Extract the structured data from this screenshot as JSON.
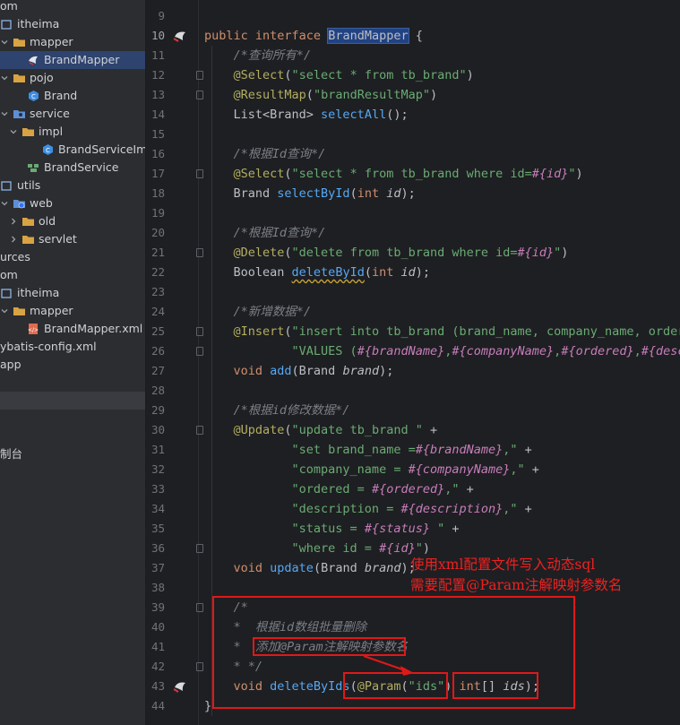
{
  "project_tree": {
    "items": [
      {
        "label": "om",
        "icon": "none-icon",
        "indent": 0,
        "chevron": ""
      },
      {
        "label": "itheima",
        "icon": "package-icon",
        "indent": 0,
        "chevron": ""
      },
      {
        "label": "mapper",
        "icon": "folder-icon",
        "indent": 0,
        "chevron": "down"
      },
      {
        "label": "BrandMapper",
        "icon": "mybatis-mapper-icon",
        "indent": 1,
        "chevron": "",
        "selected": true
      },
      {
        "label": "pojo",
        "icon": "folder-icon",
        "indent": 0,
        "chevron": "down"
      },
      {
        "label": "Brand",
        "icon": "class-icon",
        "indent": 1,
        "chevron": ""
      },
      {
        "label": "service",
        "icon": "service-package-icon",
        "indent": 0,
        "chevron": "down"
      },
      {
        "label": "impl",
        "icon": "folder-icon",
        "indent": 1,
        "chevron": "down"
      },
      {
        "label": "BrandServiceImp",
        "icon": "class-icon",
        "indent": 2,
        "chevron": ""
      },
      {
        "label": "BrandService",
        "icon": "interface-icon",
        "indent": 1,
        "chevron": ""
      },
      {
        "label": "utils",
        "icon": "package-icon",
        "indent": 0,
        "chevron": ""
      },
      {
        "label": "web",
        "icon": "web-package-icon",
        "indent": 0,
        "chevron": "down"
      },
      {
        "label": "old",
        "icon": "folder-icon",
        "indent": 1,
        "chevron": "right"
      },
      {
        "label": "servlet",
        "icon": "folder-icon",
        "indent": 1,
        "chevron": "right"
      },
      {
        "label": "urces",
        "icon": "none-icon",
        "indent": 0,
        "chevron": ""
      },
      {
        "label": "om",
        "icon": "none-icon",
        "indent": 0,
        "chevron": ""
      },
      {
        "label": "itheima",
        "icon": "package-icon",
        "indent": 0,
        "chevron": ""
      },
      {
        "label": "mapper",
        "icon": "folder-icon",
        "indent": 0,
        "chevron": "down"
      },
      {
        "label": "BrandMapper.xml",
        "icon": "xml-file-icon",
        "indent": 1,
        "chevron": ""
      },
      {
        "label": "ybatis-config.xml",
        "icon": "none-icon",
        "indent": 0,
        "chevron": ""
      },
      {
        "label": "app",
        "icon": "none-icon",
        "indent": 0,
        "chevron": ""
      },
      {
        "label": "",
        "icon": "none-icon",
        "indent": 0,
        "chevron": ""
      },
      {
        "label": "",
        "icon": "none-icon",
        "indent": 0,
        "chevron": "",
        "hover": true
      },
      {
        "label": "",
        "icon": "none-icon",
        "indent": 0,
        "chevron": ""
      },
      {
        "label": "",
        "icon": "none-icon",
        "indent": 0,
        "chevron": ""
      },
      {
        "label": "制台",
        "icon": "none-icon",
        "indent": 0,
        "chevron": ""
      }
    ]
  },
  "editor": {
    "current_line": 10,
    "lines": [
      {
        "n": 9,
        "t": []
      },
      {
        "n": 10,
        "t": [
          [
            "kw",
            "public "
          ],
          [
            "kw",
            "interface "
          ],
          [
            "hl",
            "BrandMapper"
          ],
          [
            "tp",
            " {"
          ]
        ]
      },
      {
        "n": 11,
        "t": [
          [
            "cm",
            "    /*查询所有*/"
          ]
        ]
      },
      {
        "n": 12,
        "t": [
          [
            "an",
            "    @Select"
          ],
          [
            "tp",
            "("
          ],
          [
            "st",
            "\"select * from tb_brand\""
          ],
          [
            "tp",
            ")"
          ]
        ]
      },
      {
        "n": 13,
        "t": [
          [
            "an",
            "    @ResultMap"
          ],
          [
            "tp",
            "("
          ],
          [
            "st",
            "\"brandResultMap\""
          ],
          [
            "tp",
            ")"
          ]
        ]
      },
      {
        "n": 14,
        "t": [
          [
            "tp",
            "    List<Brand> "
          ],
          [
            "fn",
            "selectAll"
          ],
          [
            "tp",
            "();"
          ]
        ]
      },
      {
        "n": 15,
        "t": []
      },
      {
        "n": 16,
        "t": [
          [
            "cm",
            "    /*根据Id查询*/"
          ]
        ]
      },
      {
        "n": 17,
        "t": [
          [
            "an",
            "    @Select"
          ],
          [
            "tp",
            "("
          ],
          [
            "st",
            "\"select * from tb_brand where id="
          ],
          [
            "ip",
            "#{id}"
          ],
          [
            "st",
            "\""
          ],
          [
            "tp",
            ")"
          ]
        ]
      },
      {
        "n": 18,
        "t": [
          [
            "tp",
            "    Brand "
          ],
          [
            "fn",
            "selectById"
          ],
          [
            "tp",
            "("
          ],
          [
            "kw",
            "int "
          ],
          [
            "pm",
            "id"
          ],
          [
            "tp",
            ");"
          ]
        ]
      },
      {
        "n": 19,
        "t": []
      },
      {
        "n": 20,
        "t": [
          [
            "cm",
            "    /*根据Id查询*/"
          ]
        ]
      },
      {
        "n": 21,
        "t": [
          [
            "an",
            "    @Delete"
          ],
          [
            "tp",
            "("
          ],
          [
            "st",
            "\"delete from tb_brand where id="
          ],
          [
            "ip",
            "#{id}"
          ],
          [
            "st",
            "\""
          ],
          [
            "tp",
            ")"
          ]
        ]
      },
      {
        "n": 22,
        "t": [
          [
            "tp",
            "    Boolean "
          ],
          [
            "fnsq",
            "deleteById"
          ],
          [
            "tp",
            "("
          ],
          [
            "kw",
            "int "
          ],
          [
            "pm",
            "id"
          ],
          [
            "tp",
            ");"
          ]
        ]
      },
      {
        "n": 23,
        "t": []
      },
      {
        "n": 24,
        "t": [
          [
            "cm",
            "    /*新增数据*/"
          ]
        ]
      },
      {
        "n": 25,
        "t": [
          [
            "an",
            "    @Insert"
          ],
          [
            "tp",
            "("
          ],
          [
            "st",
            "\"insert into tb_brand (brand_name, company_name, ordere"
          ]
        ]
      },
      {
        "n": 26,
        "t": [
          [
            "st",
            "            \"VALUES ("
          ],
          [
            "ip",
            "#{brandName}"
          ],
          [
            "st",
            ","
          ],
          [
            "ip",
            "#{companyName}"
          ],
          [
            "st",
            ","
          ],
          [
            "ip",
            "#{ordered}"
          ],
          [
            "st",
            ","
          ],
          [
            "ip",
            "#{descr"
          ]
        ]
      },
      {
        "n": 27,
        "t": [
          [
            "kw",
            "    void "
          ],
          [
            "fn",
            "add"
          ],
          [
            "tp",
            "(Brand "
          ],
          [
            "pm",
            "brand"
          ],
          [
            "tp",
            ");"
          ]
        ]
      },
      {
        "n": 28,
        "t": []
      },
      {
        "n": 29,
        "t": [
          [
            "cm",
            "    /*根据id修改数据*/"
          ]
        ]
      },
      {
        "n": 30,
        "t": [
          [
            "an",
            "    @Update"
          ],
          [
            "tp",
            "("
          ],
          [
            "st",
            "\"update tb_brand \""
          ],
          [
            "tp",
            " +"
          ]
        ]
      },
      {
        "n": 31,
        "t": [
          [
            "st",
            "            \"set brand_name ="
          ],
          [
            "ip",
            "#{brandName}"
          ],
          [
            "st",
            ",\""
          ],
          [
            "tp",
            " +"
          ]
        ]
      },
      {
        "n": 32,
        "t": [
          [
            "st",
            "            \"company_name = "
          ],
          [
            "ip",
            "#{companyName}"
          ],
          [
            "st",
            ",\""
          ],
          [
            "tp",
            " +"
          ]
        ]
      },
      {
        "n": 33,
        "t": [
          [
            "st",
            "            \"ordered = "
          ],
          [
            "ip",
            "#{ordered}"
          ],
          [
            "st",
            ",\""
          ],
          [
            "tp",
            " +"
          ]
        ]
      },
      {
        "n": 34,
        "t": [
          [
            "st",
            "            \"description = "
          ],
          [
            "ip",
            "#{description}"
          ],
          [
            "st",
            ",\""
          ],
          [
            "tp",
            " +"
          ]
        ]
      },
      {
        "n": 35,
        "t": [
          [
            "st",
            "            \"status = "
          ],
          [
            "ip",
            "#{status}"
          ],
          [
            "st",
            " \""
          ],
          [
            "tp",
            " +"
          ]
        ]
      },
      {
        "n": 36,
        "t": [
          [
            "st",
            "            \"where id = "
          ],
          [
            "ip",
            "#{id}"
          ],
          [
            "st",
            "\""
          ],
          [
            "tp",
            ")"
          ]
        ]
      },
      {
        "n": 37,
        "t": [
          [
            "kw",
            "    void "
          ],
          [
            "fn",
            "update"
          ],
          [
            "tp",
            "(Brand "
          ],
          [
            "pm",
            "brand"
          ],
          [
            "tp",
            ");"
          ]
        ]
      },
      {
        "n": 38,
        "t": []
      },
      {
        "n": 39,
        "t": [
          [
            "cm",
            "    /*"
          ]
        ]
      },
      {
        "n": 40,
        "t": [
          [
            "cm",
            "    *  根据id数组批量删除"
          ]
        ]
      },
      {
        "n": 41,
        "t": [
          [
            "cm",
            "    *  添加@Param注解映射参数名"
          ]
        ]
      },
      {
        "n": 42,
        "t": [
          [
            "cm",
            "    * */"
          ]
        ]
      },
      {
        "n": 43,
        "t": [
          [
            "kw",
            "    void "
          ],
          [
            "fn",
            "deleteByIds"
          ],
          [
            "tp",
            "("
          ],
          [
            "an",
            "@Param"
          ],
          [
            "tp",
            "("
          ],
          [
            "st",
            "\"ids\""
          ],
          [
            "tp",
            ") "
          ],
          [
            "kw",
            "int"
          ],
          [
            "tp",
            "[] "
          ],
          [
            "pm",
            "ids"
          ],
          [
            "tp",
            ");"
          ]
        ]
      },
      {
        "n": 44,
        "t": [
          [
            "tp",
            "}"
          ]
        ]
      }
    ]
  },
  "annotations": {
    "note_line1": "使用xml配置文件写入动态sql",
    "note_line2": "需要配置@Param注解映射参数名",
    "color": "#e01818"
  }
}
